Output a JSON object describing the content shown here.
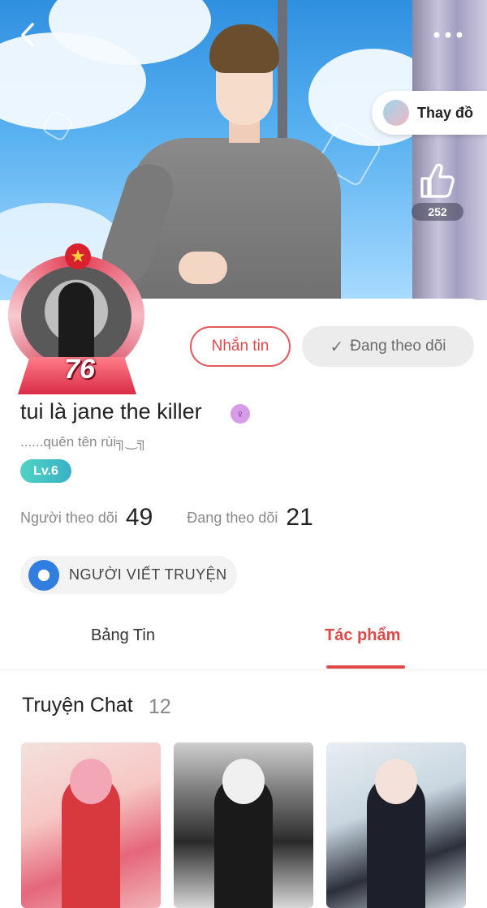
{
  "header": {
    "back_icon": "chevron-left-icon",
    "more_icon": "more-dots-icon",
    "change_outfit_label": "Thay đồ",
    "like_count": "252"
  },
  "profile": {
    "level_frame_number": "76",
    "message_button": "Nhắn tin",
    "following_button": "Đang theo dõi",
    "username": "tui là jane the killer",
    "gender_icon": "female-icon",
    "bio": "......quên tên rùi╗‿╗",
    "level_badge": "Lv.6",
    "stats": {
      "followers_label": "Người theo dõi",
      "followers_value": "49",
      "following_label": "Đang theo dõi",
      "following_value": "21"
    },
    "writer_badge": "NGƯỜI VIẾT TRUYỆN"
  },
  "tabs": [
    {
      "label": "Bảng Tin",
      "active": false
    },
    {
      "label": "Tác phẩm",
      "active": true
    }
  ],
  "section": {
    "title": "Truyện Chat",
    "count": "12"
  },
  "colors": {
    "accent": "#e04848",
    "level_badge": "#3ab1c6",
    "sky": "#59b1f0"
  }
}
